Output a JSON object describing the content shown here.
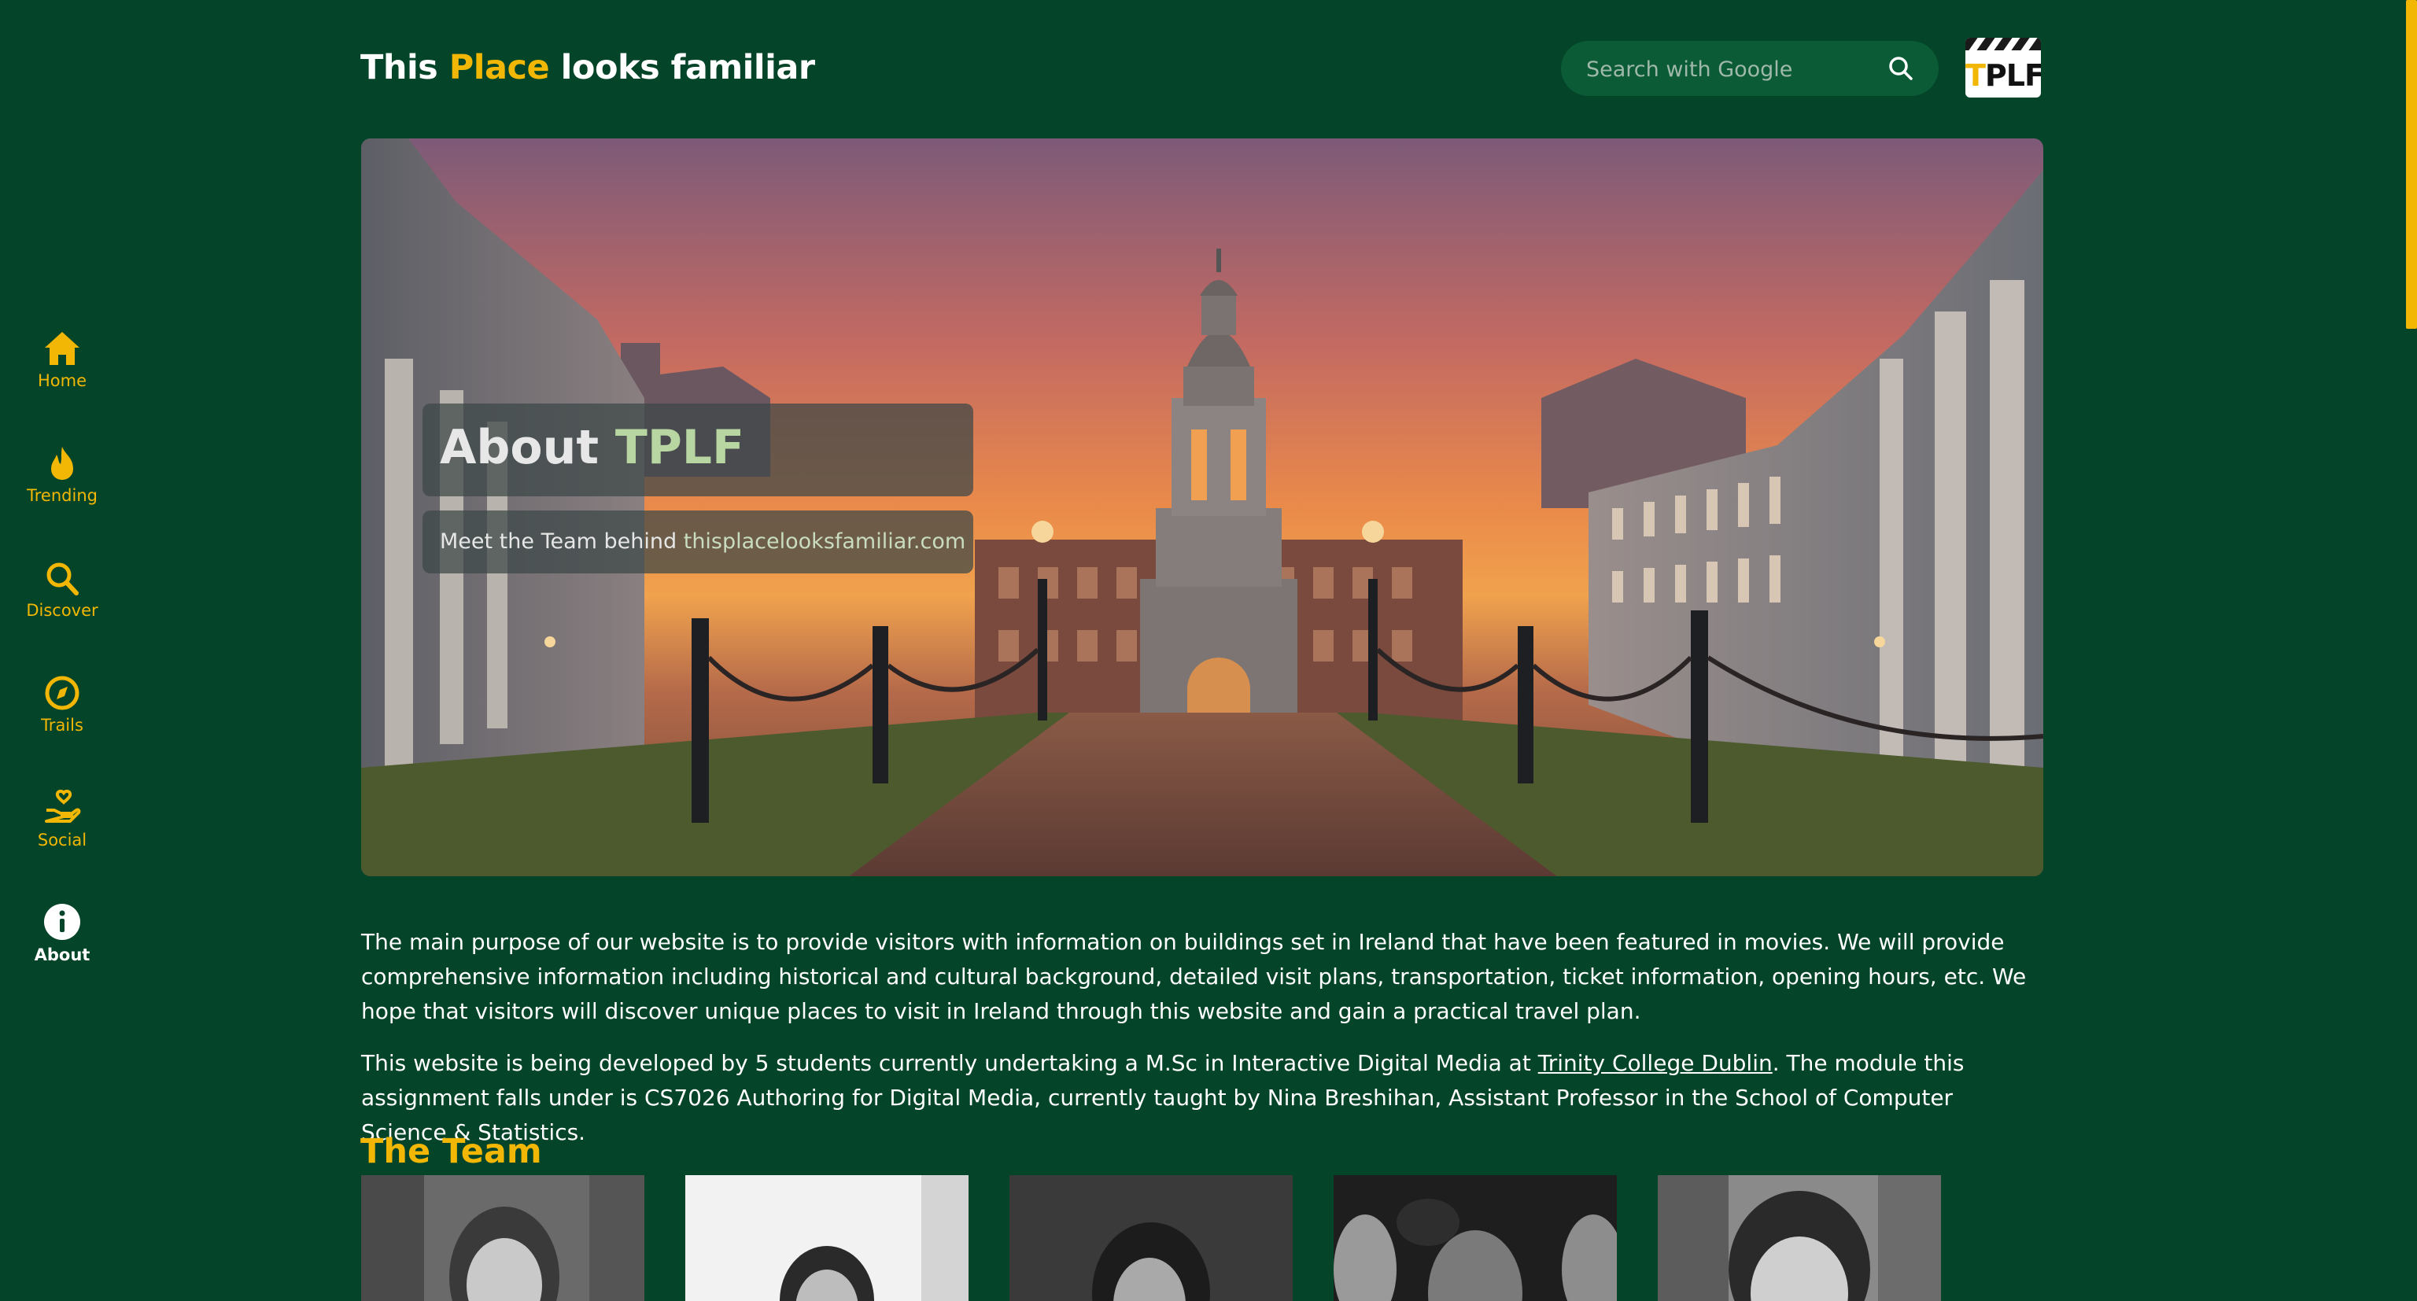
{
  "header": {
    "title_part1": "This ",
    "title_accent": "Place",
    "title_part2": " looks familiar",
    "search_placeholder": "Search with Google",
    "search_icon": "search-icon",
    "logo_text_t": "T",
    "logo_text_rest": "PLF"
  },
  "sidebar": {
    "items": [
      {
        "label": "Home",
        "icon": "home-icon"
      },
      {
        "label": "Trending",
        "icon": "flame-icon"
      },
      {
        "label": "Discover",
        "icon": "search-icon"
      },
      {
        "label": "Trails",
        "icon": "compass-icon"
      },
      {
        "label": "Social",
        "icon": "hand-heart-icon"
      },
      {
        "label": "About",
        "icon": "info-icon",
        "active": true
      }
    ]
  },
  "hero": {
    "title_part1": "About ",
    "title_accent": "TPLF",
    "subtitle_prefix": "Meet the Team behind ",
    "subtitle_link": "thisplacelooksfamiliar.com"
  },
  "intro": {
    "paragraph1": "The main purpose of our website is to provide visitors with information on buildings set in Ireland that have been featured in movies. We will provide comprehensive information including historical and cultural background, detailed visit plans, transportation, ticket information, opening hours, etc. We hope that visitors will discover unique places to visit in Ireland through this website and gain a practical travel plan.",
    "paragraph2_before": "This website is being developed by 5 students currently undertaking a M.Sc in Interactive Digital Media at ",
    "paragraph2_link": "Trinity College Dublin",
    "paragraph2_after": ". The module this assignment falls under is CS7026 Authoring for Digital Media, currently taught by Nina Breshihan, Assistant Professor in the School of Computer Science & Statistics."
  },
  "team": {
    "heading": "The Team",
    "members": 5
  },
  "colors": {
    "background": "#044428",
    "accent": "#f2b705",
    "search_bg": "#0a5b36"
  }
}
